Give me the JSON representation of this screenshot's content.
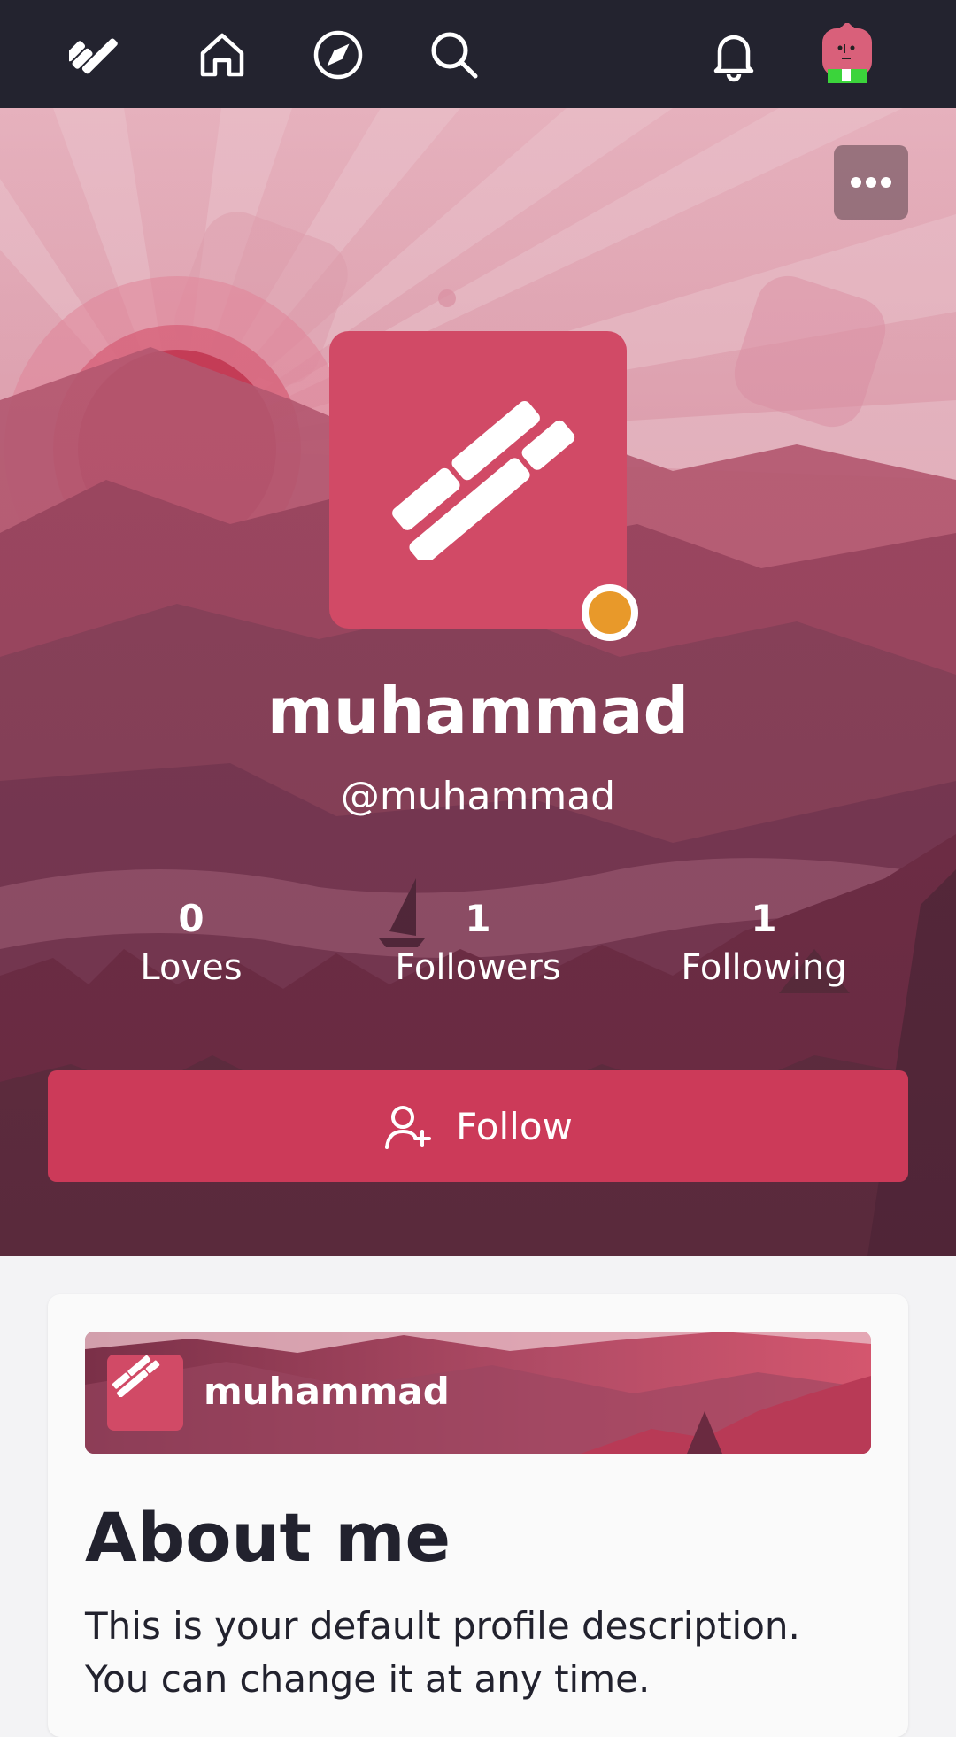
{
  "topbar": {
    "logo_icon": "stripes-logo-icon",
    "home_icon": "home-icon",
    "explore_icon": "compass-icon",
    "search_icon": "search-icon",
    "notifications_icon": "bell-icon",
    "user_avatar_icon": "user-avatar-icon"
  },
  "profile": {
    "display_name": "muhammad",
    "handle": "@muhammad",
    "status_color": "#e8992a",
    "stats": [
      {
        "value": "0",
        "label": "Loves"
      },
      {
        "value": "1",
        "label": "Followers"
      },
      {
        "value": "1",
        "label": "Following"
      }
    ],
    "follow_label": "Follow"
  },
  "about_card": {
    "banner_name": "muhammad",
    "title": "About me",
    "description": "This is your default profile description. You can change it at any time."
  },
  "colors": {
    "topbar": "#23232f",
    "accent": "#cc3a59",
    "avatar_bg": "#d14a66"
  }
}
